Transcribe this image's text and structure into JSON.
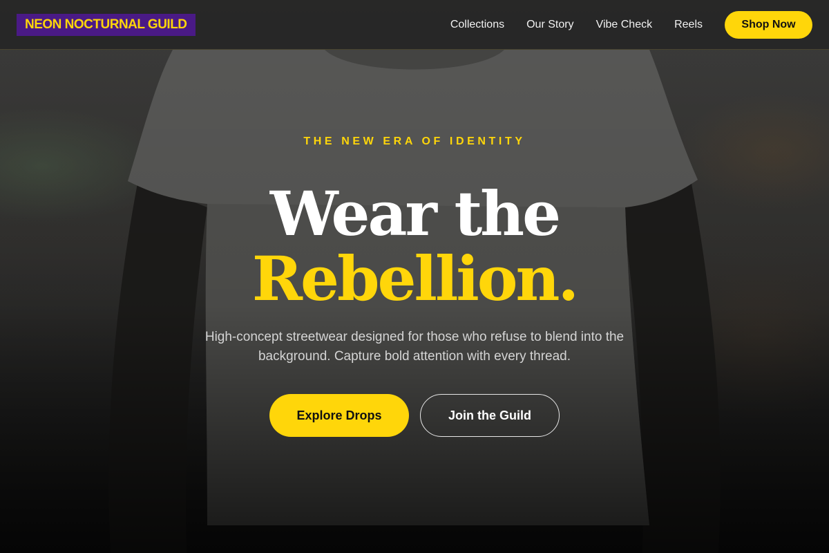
{
  "nav": {
    "logo": "NEON NOCTURNAL GUILD",
    "links": [
      "Collections",
      "Our Story",
      "Vibe Check",
      "Reels"
    ],
    "cta": "Shop Now"
  },
  "hero": {
    "eyebrow": "THE NEW ERA OF IDENTITY",
    "headline_line1": "Wear the",
    "headline_line2": "Rebellion.",
    "subtitle": "High-concept streetwear designed for those who refuse to blend into the background. Capture bold attention with every thread.",
    "primary_cta": "Explore Drops",
    "secondary_cta": "Join the Guild"
  },
  "colors": {
    "accent": "#ffd60a",
    "logo_bg": "#4a1a86",
    "nav_bg": "#262626"
  }
}
